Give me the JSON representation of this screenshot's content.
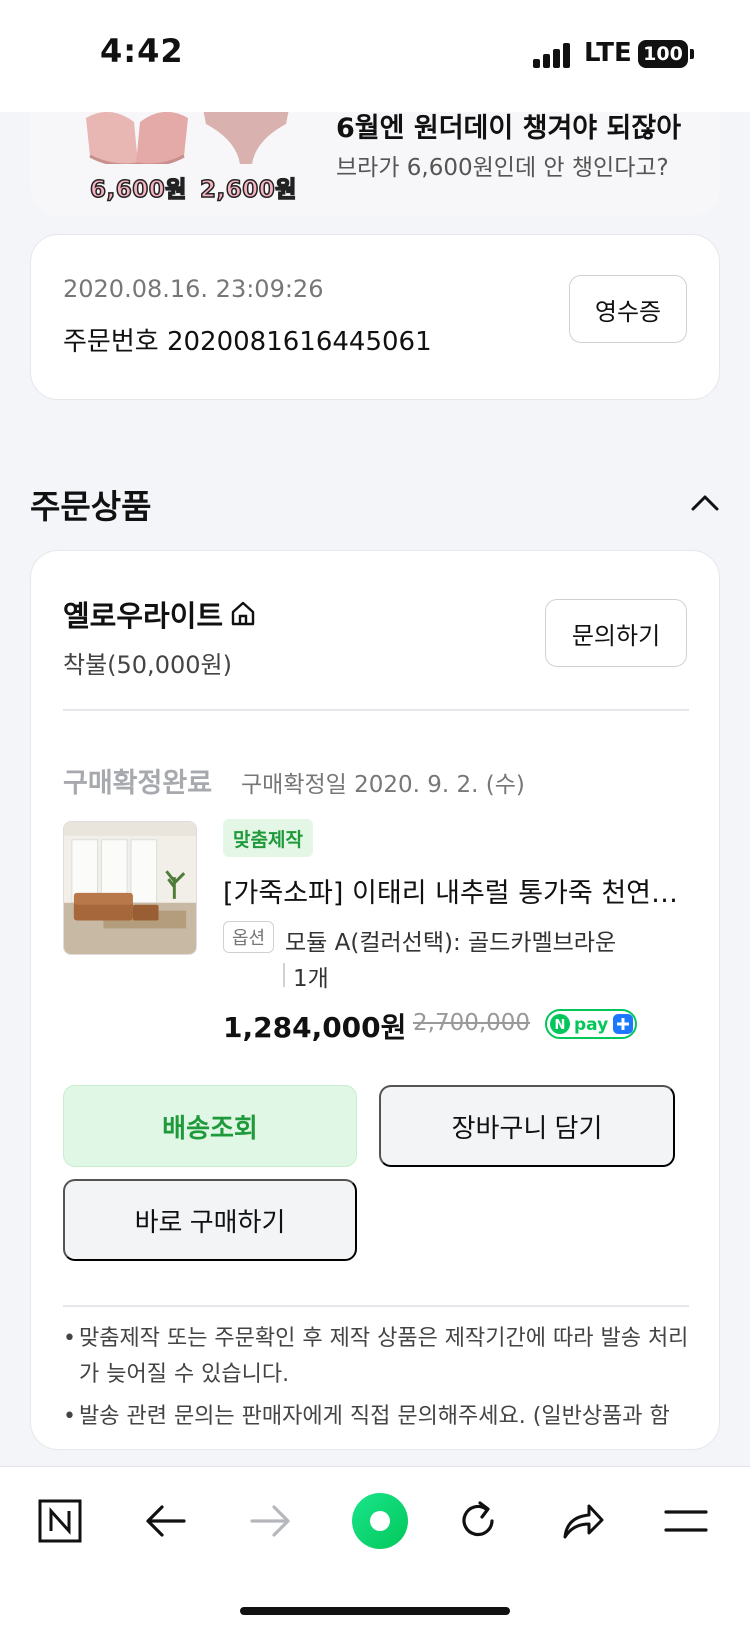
{
  "status_bar": {
    "time": "4:42",
    "network": "LTE",
    "battery": "100"
  },
  "banner": {
    "title": "6월엔 원더데이 챙겨야 되잖아",
    "subtitle": "브라가 6,600원인데 안 챙인다고?",
    "price_bra": "6,600원",
    "price_panty": "2,600원"
  },
  "order": {
    "datetime": "2020.08.16. 23:09:26",
    "number_text": "주문번호 2020081616445061",
    "receipt_label": "영수증"
  },
  "section": {
    "title": "주문상품"
  },
  "seller": {
    "name": "옐로우라이트",
    "shipping_fee": "착불(50,000원)",
    "inquiry_label": "문의하기"
  },
  "item": {
    "status": "구매확정완료",
    "confirm_date": "구매확정일 2020. 9. 2. (수)",
    "badge": "맞춤제작",
    "name": "[가죽소파] 이태리 내추럴 통가죽 천연…",
    "option_label": "옵션",
    "option_value": "모듈 A(컬러선택): 골드카멜브라운",
    "quantity": "1개",
    "price": "1,284,000원",
    "original_price": "2,700,000",
    "pay_badge": "N pay +"
  },
  "actions": {
    "track": "배송조회",
    "cart": "장바구니 담기",
    "buy": "바로 구매하기"
  },
  "notes": [
    "맞춤제작 또는 주문확인 후 제작 상품은 제작기간에 따라 발송 처리가 늦어질 수 있습니다.",
    "발송 관련 문의는 판매자에게 직접 문의해주세요. (일반상품과 함"
  ],
  "colors": {
    "accent_green": "#1f9a3b",
    "green_bg": "#dff7e4",
    "npay_green": "#03c75a"
  },
  "toolbar_icons": [
    "naver-n-icon",
    "back-arrow-icon",
    "forward-arrow-icon",
    "green-dot-home-icon",
    "refresh-icon",
    "share-icon",
    "menu-icon"
  ]
}
